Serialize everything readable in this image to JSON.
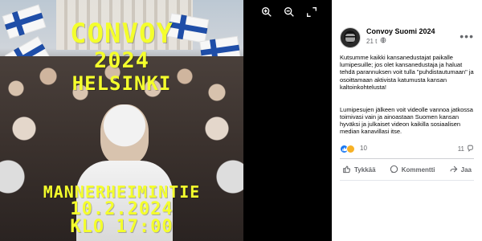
{
  "photo": {
    "title_line1": "CONVOY",
    "title_line2": "2024",
    "title_line3": "HELSINKI",
    "bottom_line1": "MANNERHEIMINTIE",
    "bottom_line2": "10.2.2024",
    "bottom_line3": "KLO 17:00"
  },
  "viewer": {
    "zoom_in_icon": "zoom-in-icon",
    "zoom_out_icon": "zoom-out-icon",
    "fullscreen_icon": "fullscreen-icon"
  },
  "post": {
    "author": "Convoy Suomi 2024",
    "time": "21 t",
    "text_p1": "Kutsumme kaikki kansanedustajat paikalle lumipesuille; jos olet kansanedustaja ja haluat tehdä parannuksen voit tulla \"puhdistautumaan\" ja osoittamaan aktivista katumusta kansan kaltoinkohtelusta!",
    "text_p2": "Lumipesujen jälkeen voit videolle vannoa jatkossa toimivasi vain ja ainoastaan Suomen kansan hyväksi ja julkaiset videon kaikilla sosiaalisen median kanavillasi itse.",
    "reaction_count": "10",
    "comment_count": "11",
    "actions": {
      "like": "Tykkää",
      "comment": "Kommentti",
      "share": "Jaa"
    }
  },
  "colors": {
    "accent_blue": "#1877f2",
    "poster_yellow": "#f4ff2c",
    "flag_blue": "#1f4ea8"
  }
}
